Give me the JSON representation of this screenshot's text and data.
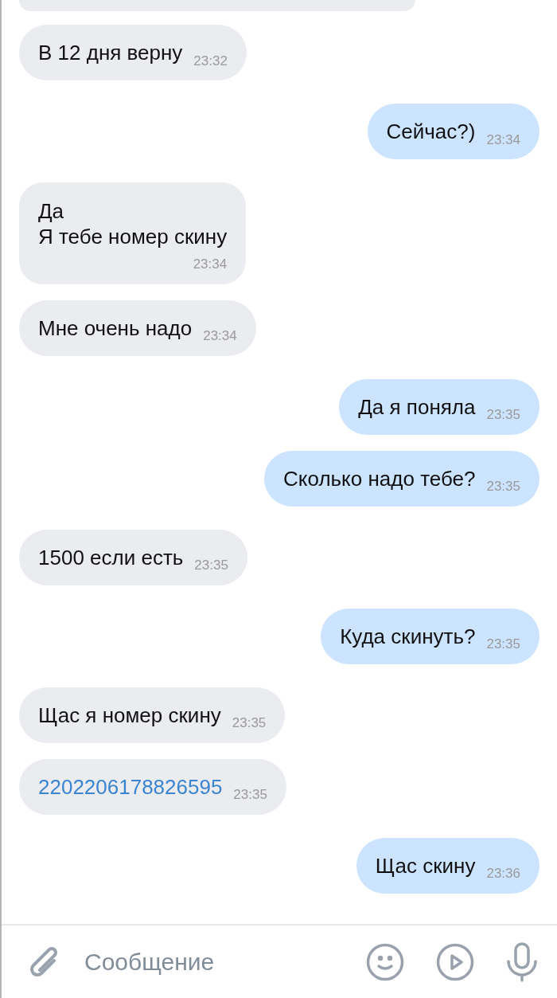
{
  "messages": [
    {
      "outgoing": false,
      "kind": "text",
      "text": "В 12 дня верну",
      "time": "23:32"
    },
    {
      "outgoing": true,
      "kind": "text",
      "text": "Сейчас?)",
      "time": "23:34"
    },
    {
      "outgoing": false,
      "kind": "multiline",
      "text": "Да\nЯ тебе номер скину",
      "time": "23:34"
    },
    {
      "outgoing": false,
      "kind": "text",
      "text": "Мне очень надо",
      "time": "23:34"
    },
    {
      "outgoing": true,
      "kind": "text",
      "text": "Да я поняла",
      "time": "23:35"
    },
    {
      "outgoing": true,
      "kind": "text",
      "text": "Сколько надо тебе?",
      "time": "23:35"
    },
    {
      "outgoing": false,
      "kind": "text",
      "text": "1500 если есть",
      "time": "23:35"
    },
    {
      "outgoing": true,
      "kind": "text",
      "text": "Куда скинуть?",
      "time": "23:35"
    },
    {
      "outgoing": false,
      "kind": "text",
      "text": "Щас я номер скину",
      "time": "23:35"
    },
    {
      "outgoing": false,
      "kind": "link",
      "text": "2202206178826595",
      "time": "23:35"
    },
    {
      "outgoing": true,
      "kind": "text",
      "text": "Щас скину",
      "time": "23:36"
    }
  ],
  "composer": {
    "placeholder": "Сообщение"
  }
}
